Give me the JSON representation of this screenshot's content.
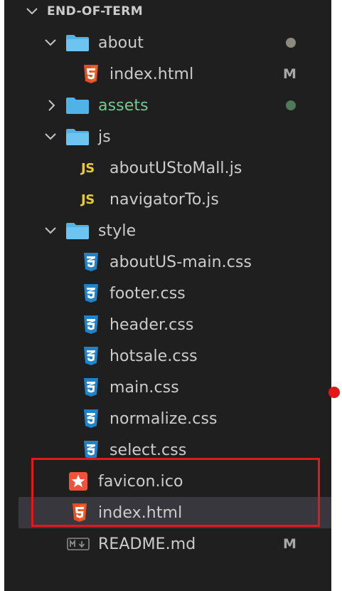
{
  "explorer": {
    "root_label": "END-OF-TERM",
    "items": [
      {
        "label": "about",
        "kind": "folder",
        "expanded": true,
        "icon": "folder-icon"
      },
      {
        "label": "index.html",
        "kind": "html",
        "status": "M",
        "icon": "html5-icon"
      },
      {
        "label": "assets",
        "kind": "folder",
        "expanded": false,
        "icon": "folder-icon"
      },
      {
        "label": "js",
        "kind": "folder",
        "expanded": true,
        "icon": "folder-icon"
      },
      {
        "label": "aboutUStoMall.js",
        "kind": "js",
        "icon": "js-icon",
        "icon_text": "JS"
      },
      {
        "label": "navigatorTo.js",
        "kind": "js",
        "icon": "js-icon",
        "icon_text": "JS"
      },
      {
        "label": "style",
        "kind": "folder",
        "expanded": true,
        "icon": "folder-icon"
      },
      {
        "label": "aboutUS-main.css",
        "kind": "css",
        "icon": "css3-icon"
      },
      {
        "label": "footer.css",
        "kind": "css",
        "icon": "css3-icon"
      },
      {
        "label": "header.css",
        "kind": "css",
        "icon": "css3-icon"
      },
      {
        "label": "hotsale.css",
        "kind": "css",
        "icon": "css3-icon"
      },
      {
        "label": "main.css",
        "kind": "css",
        "icon": "css3-icon"
      },
      {
        "label": "normalize.css",
        "kind": "css",
        "icon": "css3-icon"
      },
      {
        "label": "select.css",
        "kind": "css",
        "icon": "css3-icon"
      },
      {
        "label": "favicon.ico",
        "kind": "ico",
        "icon": "favicon-star-icon"
      },
      {
        "label": "index.html",
        "kind": "html",
        "icon": "html5-icon",
        "selected": true
      },
      {
        "label": "README.md",
        "kind": "md",
        "status": "M",
        "icon": "markdown-icon"
      }
    ]
  },
  "colors": {
    "background": "#1f1f1f",
    "text": "#cccccc",
    "git_added": "#73c991",
    "modified_dot": "#8c8a7e",
    "added_dot": "#4f7a58",
    "folder": "#4fb3e8",
    "html5": "#e44d26",
    "css3": "#1f83c9",
    "js": "#e8c93a",
    "highlight_box": "#e5161c",
    "selected_row": "#37373d"
  }
}
